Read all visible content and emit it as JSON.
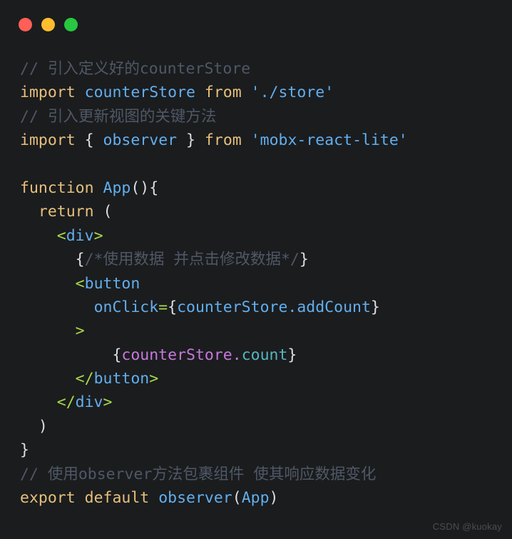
{
  "window": {
    "traffic_lights": [
      {
        "name": "close-button",
        "label": "close",
        "color": "#FF5F57"
      },
      {
        "name": "minimize-button",
        "label": "minimize",
        "color": "#FFBD2E"
      },
      {
        "name": "maximize-button",
        "label": "maximize",
        "color": "#28C840"
      }
    ]
  },
  "watermark": "CSDN @kuokay",
  "theme": {
    "background": "#1B1C1E",
    "comment": "#4F5866",
    "keyword": "#E5C07B",
    "identifier": "#61AFEF",
    "string": "#61AFEF",
    "plain": "#DCDFE4",
    "bracket": "#A9D94B",
    "purple": "#C678DD",
    "cyan": "#56B6C2"
  },
  "code": {
    "language": "jsx",
    "full_text": "// 引入定义好的counterStore\nimport counterStore from './store'\n// 引入更新视图的关键方法\nimport { observer } from 'mobx-react-lite'\n\nfunction App(){\n  return (\n    <div>\n      {/*使用数据 并点击修改数据*/}\n      <button\n        onClick={counterStore.addCount}\n      >\n          {counterStore.count}\n      </button>\n    </div>\n  )\n}\n// 使用observer方法包裹组件 使其响应数据变化\nexport default observer(App)",
    "lines": [
      {
        "text": "// 引入定义好的counterStore"
      },
      {
        "text": "import counterStore from './store'"
      },
      {
        "text": "// 引入更新视图的关键方法"
      },
      {
        "text": "import { observer } from 'mobx-react-lite'"
      },
      {
        "text": ""
      },
      {
        "text": "function App(){"
      },
      {
        "text": "  return ("
      },
      {
        "text": "    <div>"
      },
      {
        "text": "      {/*使用数据 并点击修改数据*/}"
      },
      {
        "text": "      <button"
      },
      {
        "text": "        onClick={counterStore.addCount}"
      },
      {
        "text": "      >"
      },
      {
        "text": "          {counterStore.count}"
      },
      {
        "text": "      </button>"
      },
      {
        "text": "    </div>"
      },
      {
        "text": "  )"
      },
      {
        "text": "}"
      },
      {
        "text": "// 使用observer方法包裹组件 使其响应数据变化"
      },
      {
        "text": "export default observer(App)"
      }
    ],
    "tokens": {
      "l0": [
        {
          "t": "// 引入定义好的counterStore",
          "c": "comment"
        }
      ],
      "l1": [
        {
          "t": "import",
          "c": "keyword"
        },
        {
          "t": " ",
          "c": "plain"
        },
        {
          "t": "counterStore",
          "c": "ident"
        },
        {
          "t": " ",
          "c": "plain"
        },
        {
          "t": "from",
          "c": "keyword"
        },
        {
          "t": " ",
          "c": "plain"
        },
        {
          "t": "'./store'",
          "c": "string"
        }
      ],
      "l2": [
        {
          "t": "// 引入更新视图的关键方法",
          "c": "comment"
        }
      ],
      "l3": [
        {
          "t": "import",
          "c": "keyword"
        },
        {
          "t": " ",
          "c": "plain"
        },
        {
          "t": "{",
          "c": "plain"
        },
        {
          "t": " ",
          "c": "plain"
        },
        {
          "t": "observer",
          "c": "ident"
        },
        {
          "t": " ",
          "c": "plain"
        },
        {
          "t": "}",
          "c": "plain"
        },
        {
          "t": " ",
          "c": "plain"
        },
        {
          "t": "from",
          "c": "keyword"
        },
        {
          "t": " ",
          "c": "plain"
        },
        {
          "t": "'mobx-react-lite'",
          "c": "string"
        }
      ],
      "l4": [],
      "l5": [
        {
          "t": "function",
          "c": "keyword"
        },
        {
          "t": " ",
          "c": "plain"
        },
        {
          "t": "App",
          "c": "ident"
        },
        {
          "t": "(){",
          "c": "plain"
        }
      ],
      "l6": [
        {
          "t": "  ",
          "c": "plain"
        },
        {
          "t": "return",
          "c": "keyword"
        },
        {
          "t": " ",
          "c": "plain"
        },
        {
          "t": "(",
          "c": "plain"
        }
      ],
      "l7": [
        {
          "t": "    ",
          "c": "plain"
        },
        {
          "t": "<",
          "c": "bracket"
        },
        {
          "t": "div",
          "c": "tag"
        },
        {
          "t": ">",
          "c": "bracket"
        }
      ],
      "l8": [
        {
          "t": "      ",
          "c": "plain"
        },
        {
          "t": "{",
          "c": "plain"
        },
        {
          "t": "/*使用数据 并点击修改数据*/",
          "c": "comment"
        },
        {
          "t": "}",
          "c": "plain"
        }
      ],
      "l9": [
        {
          "t": "      ",
          "c": "plain"
        },
        {
          "t": "<",
          "c": "bracket"
        },
        {
          "t": "button",
          "c": "tag"
        }
      ],
      "l10": [
        {
          "t": "        ",
          "c": "plain"
        },
        {
          "t": "onClick",
          "c": "attr"
        },
        {
          "t": "=",
          "c": "eq"
        },
        {
          "t": "{",
          "c": "plain"
        },
        {
          "t": "counterStore.addCount",
          "c": "ident"
        },
        {
          "t": "}",
          "c": "plain"
        }
      ],
      "l11": [
        {
          "t": "      ",
          "c": "plain"
        },
        {
          "t": ">",
          "c": "bracket"
        }
      ],
      "l12": [
        {
          "t": "          ",
          "c": "plain"
        },
        {
          "t": "{",
          "c": "plain"
        },
        {
          "t": "counterStore.",
          "c": "purple"
        },
        {
          "t": "count",
          "c": "cyan"
        },
        {
          "t": "}",
          "c": "plain"
        }
      ],
      "l13": [
        {
          "t": "      ",
          "c": "plain"
        },
        {
          "t": "</",
          "c": "bracket"
        },
        {
          "t": "button",
          "c": "tag"
        },
        {
          "t": ">",
          "c": "bracket"
        }
      ],
      "l14": [
        {
          "t": "    ",
          "c": "plain"
        },
        {
          "t": "</",
          "c": "bracket"
        },
        {
          "t": "div",
          "c": "tag"
        },
        {
          "t": ">",
          "c": "bracket"
        }
      ],
      "l15": [
        {
          "t": "  ",
          "c": "plain"
        },
        {
          "t": ")",
          "c": "plain"
        }
      ],
      "l16": [
        {
          "t": "}",
          "c": "plain"
        }
      ],
      "l17": [
        {
          "t": "// 使用observer方法包裹组件 使其响应数据变化",
          "c": "comment"
        }
      ],
      "l18": [
        {
          "t": "export",
          "c": "keyword"
        },
        {
          "t": " ",
          "c": "plain"
        },
        {
          "t": "default",
          "c": "keyword"
        },
        {
          "t": " ",
          "c": "plain"
        },
        {
          "t": "observer",
          "c": "ident"
        },
        {
          "t": "(",
          "c": "plain"
        },
        {
          "t": "App",
          "c": "ident"
        },
        {
          "t": ")",
          "c": "plain"
        }
      ]
    }
  }
}
